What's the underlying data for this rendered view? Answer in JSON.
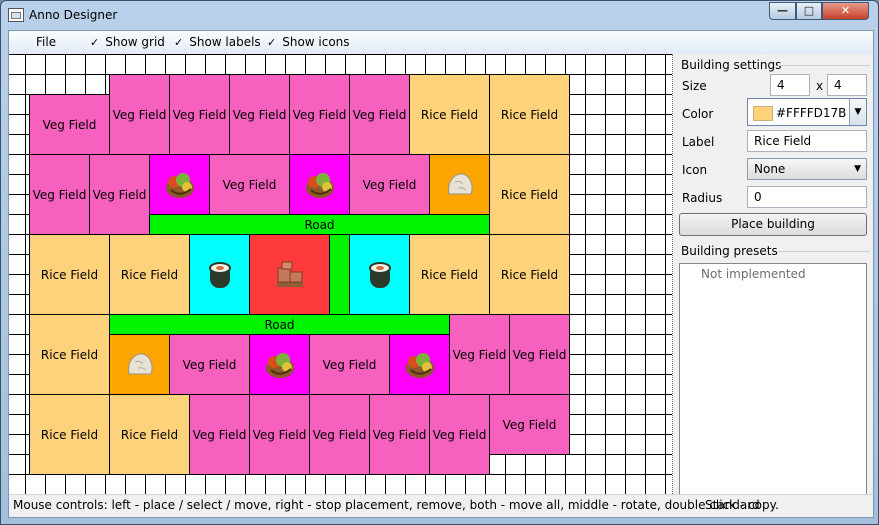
{
  "window": {
    "title": "Anno Designer",
    "min_label": "—",
    "max_label": "□",
    "close_label": "✕"
  },
  "menu": {
    "file": "File",
    "show_grid": "Show grid",
    "show_labels": "Show labels",
    "show_icons": "Show icons",
    "check_mark": "✓"
  },
  "canvas": {
    "veg_label": "Veg Field",
    "rice_label": "Rice Field",
    "road_label": "Road"
  },
  "settings": {
    "group_title": "Building settings",
    "size_label": "Size",
    "size_w": "4",
    "size_x": "x",
    "size_h": "4",
    "color_label": "Color",
    "color_value": "#FFFFD17B",
    "label_label": "Label",
    "label_value": "Rice Field",
    "icon_label": "Icon",
    "icon_value": "None",
    "radius_label": "Radius",
    "radius_value": "0",
    "place_button": "Place building"
  },
  "presets": {
    "group_title": "Building presets",
    "placeholder": "Not implemented"
  },
  "status": {
    "left": "Mouse controls: left - place / select / move, right - stop placement, remove, both - move all, middle - rotate, double click - copy.",
    "right": "Standard"
  },
  "colors": {
    "veg": "#f660be",
    "rice": "#fed17b",
    "road": "#00f300",
    "accent": "#ff00ff"
  },
  "icons": [
    "fruit-basket-icon",
    "rock-icon",
    "sushi-roll-icon",
    "brick-pallet-icon"
  ]
}
